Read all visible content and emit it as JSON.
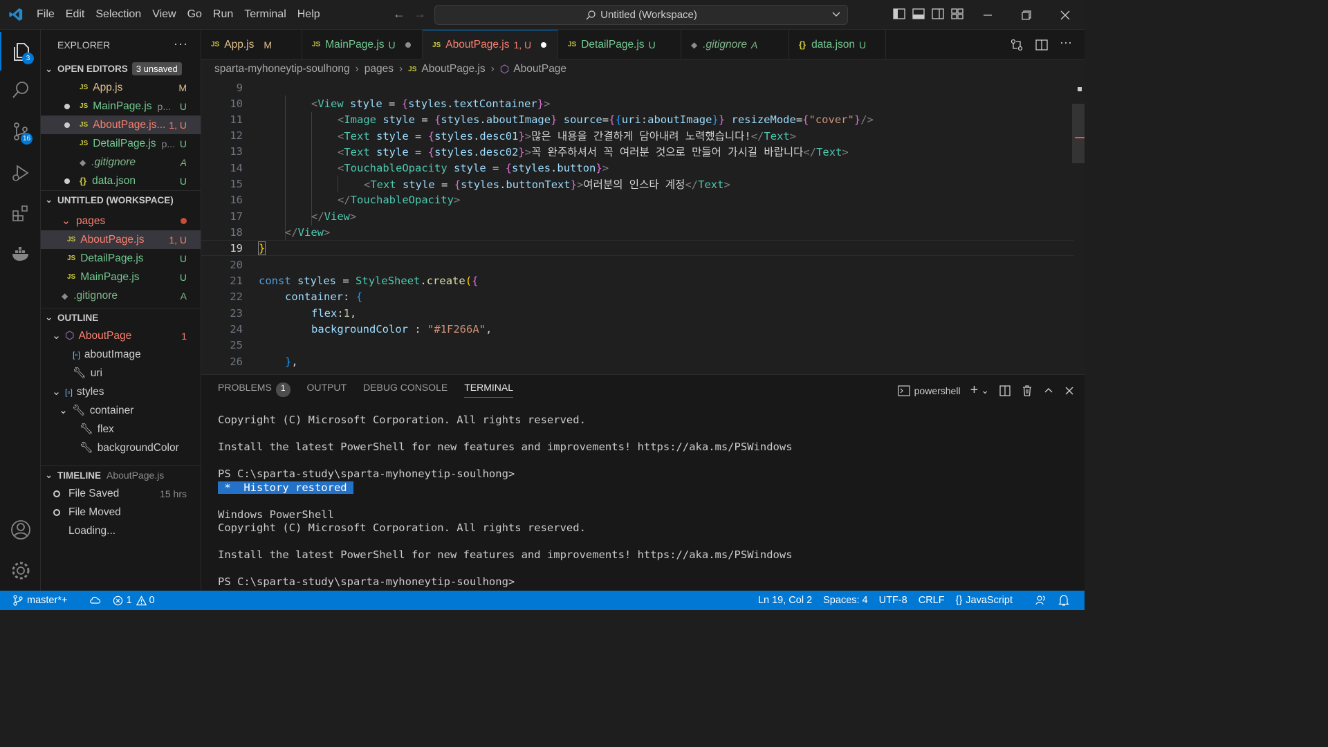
{
  "titlebar": {
    "menu": [
      "File",
      "Edit",
      "Selection",
      "View",
      "Go",
      "Run",
      "Terminal",
      "Help"
    ],
    "command_center": "Untitled (Workspace)"
  },
  "activity": {
    "explorer_badge": "3",
    "scm_badge": "16"
  },
  "sidebar": {
    "title": "EXPLORER",
    "more": "···",
    "open_editors": {
      "header": "OPEN EDITORS",
      "unsaved": "3 unsaved",
      "items": [
        {
          "icon": "JS",
          "name": "App.js",
          "path": "",
          "deco": "M"
        },
        {
          "icon": "JS",
          "name": "MainPage.js",
          "path": "p...",
          "deco": "U"
        },
        {
          "icon": "JS",
          "name": "AboutPage.js...",
          "path": "",
          "deco": "1, U"
        },
        {
          "icon": "JS",
          "name": "DetailPage.js",
          "path": "p...",
          "deco": "U"
        },
        {
          "icon": "◆",
          "name": ".gitignore",
          "path": "",
          "deco": "A"
        },
        {
          "icon": "{}",
          "name": "data.json",
          "path": "",
          "deco": "U"
        }
      ]
    },
    "workspace": {
      "header": "UNTITLED (WORKSPACE)",
      "folder": "pages",
      "files": [
        {
          "name": "AboutPage.js",
          "deco": "1, U"
        },
        {
          "name": "DetailPage.js",
          "deco": "U"
        },
        {
          "name": "MainPage.js",
          "deco": "U"
        }
      ],
      "gitignore": ".gitignore",
      "gitignore_deco": "A"
    },
    "outline": {
      "header": "OUTLINE",
      "root": "AboutPage",
      "root_count": "1",
      "items": [
        "aboutImage",
        "uri",
        "styles",
        "container",
        "flex",
        "backgroundColor"
      ]
    },
    "timeline": {
      "header": "TIMELINE",
      "file": "AboutPage.js",
      "items": [
        {
          "label": "File Saved",
          "time": "15 hrs"
        },
        {
          "label": "File Moved",
          "time": ""
        },
        {
          "label": "Loading...",
          "time": ""
        }
      ]
    }
  },
  "tabs": [
    {
      "icon": "JS",
      "name": "App.js",
      "deco": "M"
    },
    {
      "icon": "JS",
      "name": "MainPage.js",
      "deco": "U"
    },
    {
      "icon": "JS",
      "name": "AboutPage.js",
      "deco": "1, U"
    },
    {
      "icon": "JS",
      "name": "DetailPage.js",
      "deco": "U"
    },
    {
      "icon": "◆",
      "name": ".gitignore",
      "deco": "A"
    },
    {
      "icon": "{}",
      "name": "data.json",
      "deco": "U"
    }
  ],
  "breadcrumb": [
    "sparta-myhoneytip-soulhong",
    "pages",
    "AboutPage.js",
    "AboutPage"
  ],
  "editor": {
    "line_numbers": [
      "9",
      "10",
      "11",
      "12",
      "13",
      "14",
      "15",
      "16",
      "17",
      "18",
      "19",
      "20",
      "21",
      "22",
      "23",
      "24",
      "25",
      "26"
    ],
    "desc01": "많은 내용을 간결하게 담아내려 노력했습니다!",
    "desc02": "꼭 완주하셔서 꼭 여러분 것으로 만들어 가시길 바랍니다",
    "button_text": "여러분의 인스타 계정",
    "resize_mode": "\"cover\"",
    "background_color": "\"#1F266A\""
  },
  "panel": {
    "tabs": [
      "PROBLEMS",
      "OUTPUT",
      "DEBUG CONSOLE",
      "TERMINAL"
    ],
    "problems_count": "1",
    "shell": "powershell",
    "terminal_lines": [
      "Copyright (C) Microsoft Corporation. All rights reserved.",
      "",
      "Install the latest PowerShell for new features and improvements! https://aka.ms/PSWindows",
      "",
      "PS C:\\sparta-study\\sparta-myhoneytip-soulhong>"
    ],
    "history": " *  History restored ",
    "terminal_lines2": [
      "",
      "Windows PowerShell",
      "Copyright (C) Microsoft Corporation. All rights reserved.",
      "",
      "Install the latest PowerShell for new features and improvements! https://aka.ms/PSWindows",
      "",
      "PS C:\\sparta-study\\sparta-myhoneytip-soulhong>"
    ]
  },
  "statusbar": {
    "branch": "master*+",
    "errors": "1",
    "warnings": "0",
    "position": "Ln 19, Col 2",
    "spaces": "Spaces: 4",
    "encoding": "UTF-8",
    "eol": "CRLF",
    "language": "JavaScript"
  },
  "colors": {
    "accent": "#0078d4",
    "status_bar": "#0078d4",
    "untracked": "#73c991",
    "modified": "#e2c08d",
    "error": "#f88070"
  }
}
